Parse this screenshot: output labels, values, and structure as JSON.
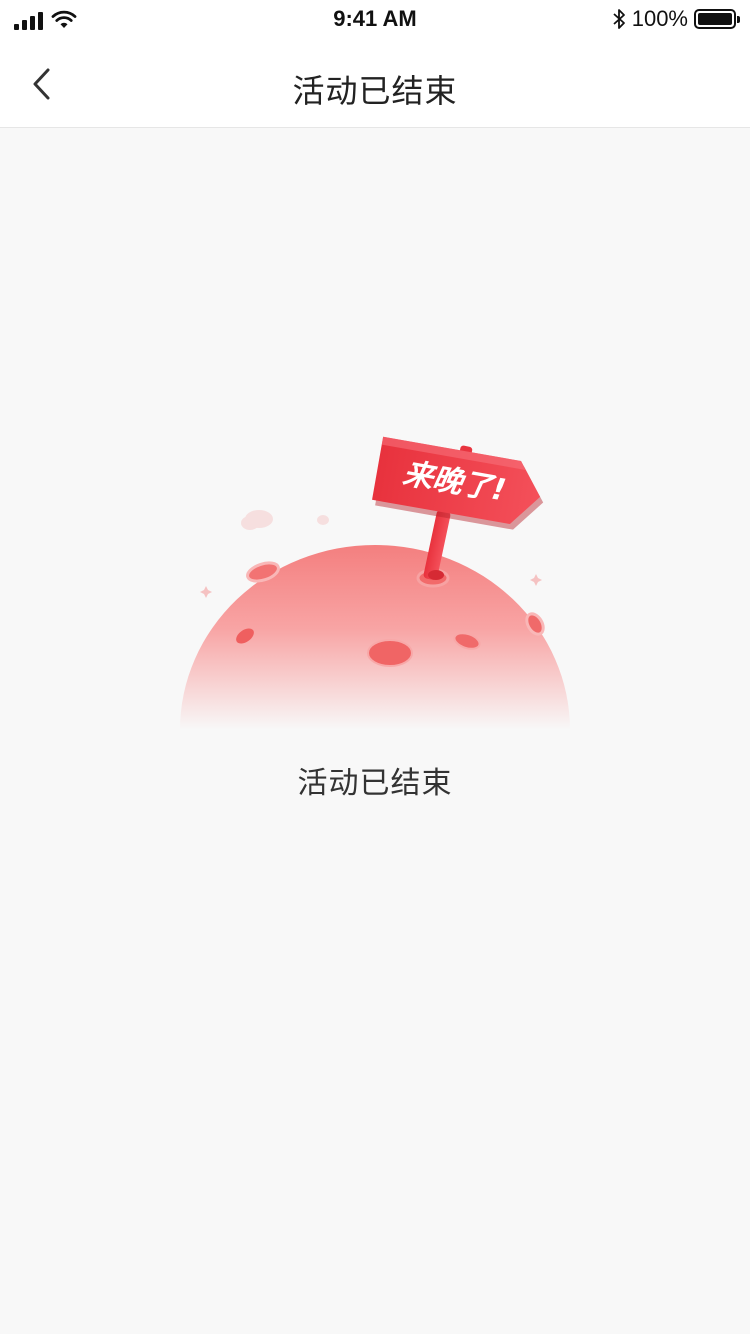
{
  "status_bar": {
    "time": "9:41 AM",
    "battery": "100%",
    "icons": [
      "signal-icon",
      "wifi-icon",
      "bluetooth-icon",
      "battery-icon"
    ]
  },
  "navbar": {
    "title": "活动已结束",
    "back_icon": "chevron-left-icon"
  },
  "illustration": {
    "sign_text": "来晚了!",
    "colors": {
      "planet": "#f47a7a",
      "sign": "#ef3b44",
      "accent": "#e63946"
    }
  },
  "message": "活动已结束"
}
